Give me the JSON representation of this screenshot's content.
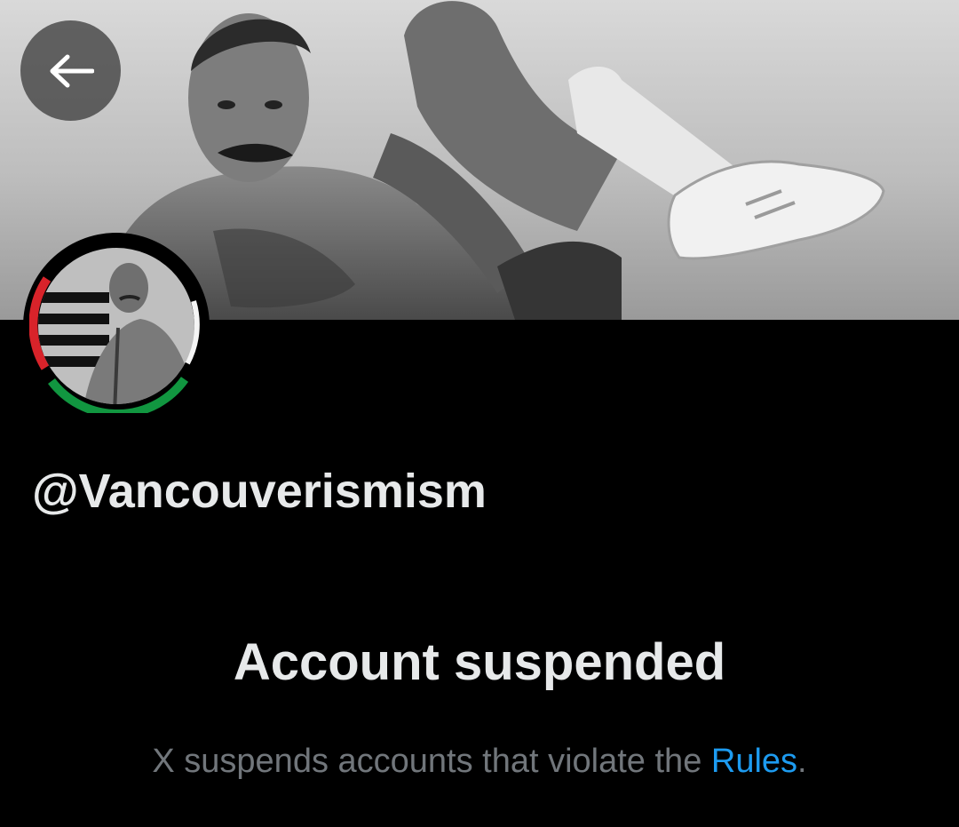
{
  "banner": {
    "image": "black-and-white photo of a shirtless man with a mustache lying back with one leg raised"
  },
  "back_button": {
    "icon": "arrow-left-icon"
  },
  "avatar": {
    "image": "circular profile photo with red, white, black and green ring"
  },
  "profile": {
    "handle": "@Vancouverismism"
  },
  "suspension": {
    "title": "Account suspended",
    "message_prefix": "X suspends accounts that violate the ",
    "rules_link": "Rules",
    "message_suffix": "."
  },
  "colors": {
    "background": "#000000",
    "primary_text": "#e7e9ea",
    "secondary_text": "#71767b",
    "link": "#1d9bf0",
    "ring_red": "#d8232a",
    "ring_green": "#119640"
  }
}
